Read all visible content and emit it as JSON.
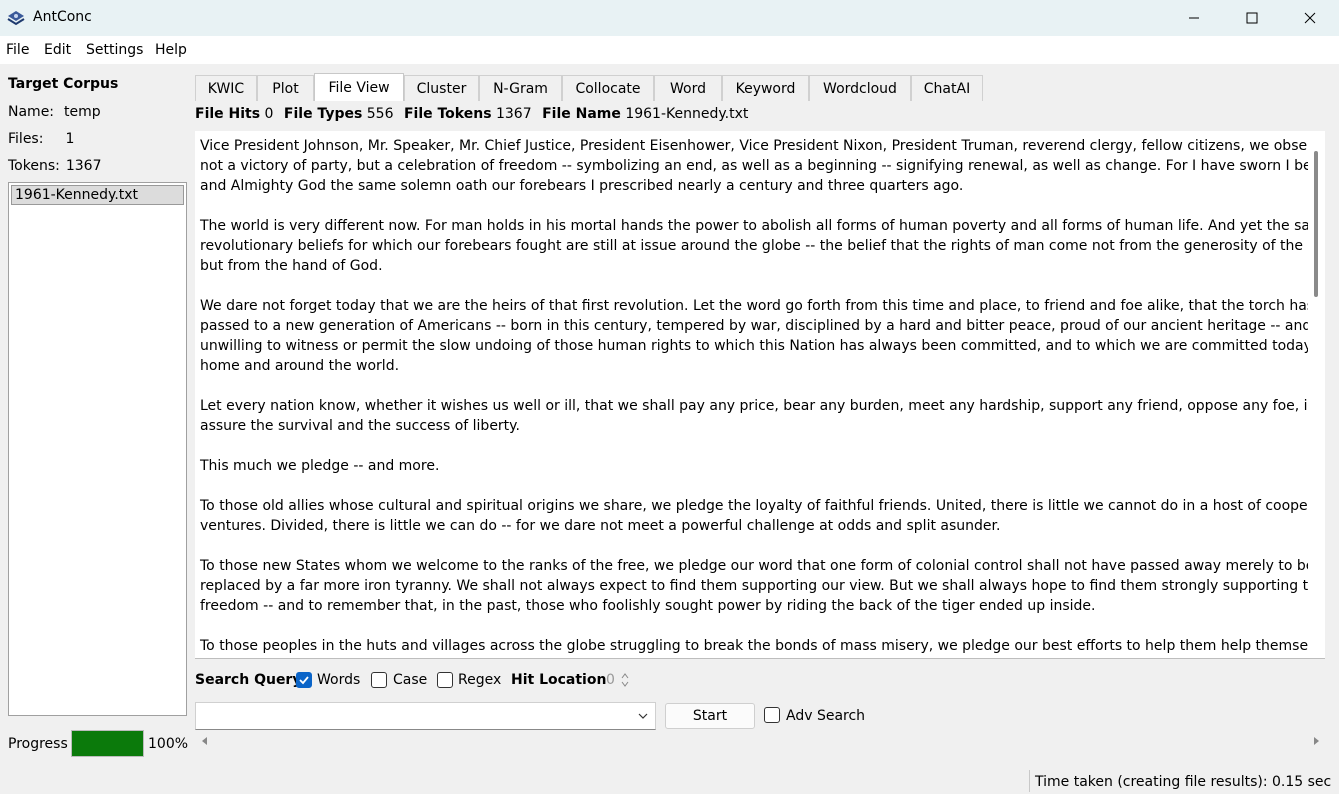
{
  "window": {
    "title": "AntConc"
  },
  "menu": [
    "File",
    "Edit",
    "Settings",
    "Help"
  ],
  "corpus": {
    "title": "Target Corpus",
    "name_label": "Name:",
    "name_value": "temp",
    "files_label": "Files:",
    "files_value": "1",
    "tokens_label": "Tokens:",
    "tokens_value": "1367",
    "files": [
      "1961-Kennedy.txt"
    ]
  },
  "progress": {
    "label": "Progress",
    "percent_text": "100%",
    "value": 100
  },
  "tabs": [
    "KWIC",
    "Plot",
    "File View",
    "Cluster",
    "N-Gram",
    "Collocate",
    "Word",
    "Keyword",
    "Wordcloud",
    "ChatAI"
  ],
  "active_tab": "File View",
  "stats": {
    "file_hits_label": "File Hits",
    "file_hits": "0",
    "file_types_label": "File Types",
    "file_types": "556",
    "file_tokens_label": "File Tokens",
    "file_tokens": "1367",
    "file_name_label": "File Name",
    "file_name": "1961-Kennedy.txt"
  },
  "text_paragraphs": [
    [
      "Vice President Johnson, Mr. Speaker, Mr. Chief Justice, President Eisenhower, Vice President Nixon, President Truman, reverend clergy, fellow citizens, we observe today",
      "not a victory of party, but a celebration of freedom -- symbolizing an end, as well as a beginning -- signifying renewal, as well as change. For I have sworn I before you",
      "and Almighty God the same solemn oath our forebears I prescribed nearly a century and three quarters ago."
    ],
    [
      "The world is very different now. For man holds in his mortal hands the power to abolish all forms of human poverty and all forms of human life. And yet the same",
      "revolutionary beliefs for which our forebears fought are still at issue around the globe -- the belief that the rights of man come not from the generosity of the state,",
      "but from the hand of God."
    ],
    [
      "We dare not forget today that we are the heirs of that first revolution. Let the word go forth from this time and place, to friend and foe alike, that the torch has been",
      "passed to a new generation of Americans -- born in this century, tempered by war, disciplined by a hard and bitter peace, proud of our ancient heritage -- and",
      "unwilling to witness or permit the slow undoing of those human rights to which this Nation has always been committed, and to which we are committed today at",
      "home and around the world."
    ],
    [
      "Let every nation know, whether it wishes us well or ill, that we shall pay any price, bear any burden, meet any hardship, support any friend, oppose any foe, in order to",
      "assure the survival and the success of liberty."
    ],
    [
      "This much we pledge -- and more."
    ],
    [
      "To those old allies whose cultural and spiritual origins we share, we pledge the loyalty of faithful friends. United, there is little we cannot do in a host of cooperative",
      "ventures. Divided, there is little we can do -- for we dare not meet a powerful challenge at odds and split asunder."
    ],
    [
      "To those new States whom we welcome to the ranks of the free, we pledge our word that one form of colonial control shall not have passed away merely to be",
      "replaced by a far more iron tyranny. We shall not always expect to find them supporting our view. But we shall always hope to find them strongly supporting their own",
      "freedom -- and to remember that, in the past, those who foolishly sought power by riding the back of the tiger ended up inside."
    ],
    [
      "To those peoples in the huts and villages across the globe struggling to break the bonds of mass misery, we pledge our best efforts to help them help themselves, for"
    ]
  ],
  "search": {
    "query_label": "Search Query",
    "words_label": "Words",
    "words_checked": true,
    "case_label": "Case",
    "case_checked": false,
    "regex_label": "Regex",
    "regex_checked": false,
    "hit_location_label": "Hit Location",
    "hit_location_value": "0",
    "query_value": "",
    "start_label": "Start",
    "adv_search_label": "Adv Search",
    "adv_search_checked": false
  },
  "status": {
    "text": "Time taken (creating file results):  0.15 sec"
  },
  "colors": {
    "progress_fill": "#0b7a0b",
    "checkbox_checked": "#0a64c8",
    "titlebar": "#e8f2f4"
  }
}
